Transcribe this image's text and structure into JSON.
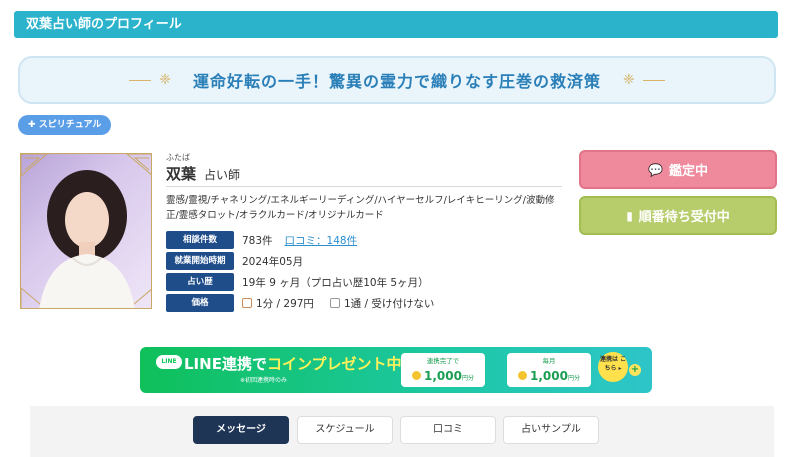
{
  "header": {
    "title": "双葉占い師のプロフィール"
  },
  "banner": {
    "text": "運命好転の一手！驚異の霊力で織りなす圧巻の救済策"
  },
  "tag": {
    "label": "スピリチュアル"
  },
  "profile": {
    "kana": "ふたば",
    "name": "双葉",
    "title": "占い師",
    "skills": "霊感/霊視/チャネリング/エネルギーリーディング/ハイヤーセルフ/レイキヒーリング/波動修正/霊感タロット/オラクルカード/オリジナルカード",
    "info": [
      {
        "label": "相談件数",
        "value": "783件",
        "link": "口コミ：148件"
      },
      {
        "label": "就業開始時期",
        "value": "2024年05月"
      },
      {
        "label": "占い歴",
        "value": "19年 9 ヶ月（プロ占い歴10年 5ヶ月）"
      },
      {
        "label": "価格",
        "phone_price": "1分 / 297円",
        "mail_price": "1通 / 受け付けない"
      }
    ]
  },
  "actions": {
    "status_label": "鑑定中",
    "queue_label": "順番待ち受付中"
  },
  "line_promo": {
    "badge": "LINE",
    "main_prefix": "LINE連携で",
    "main_highlight": "コインプレゼント中!",
    "note": "※初回連携時のみ",
    "reward1_caption": "連携完了で",
    "reward1_amount": "1,000",
    "reward1_unit": "円分",
    "reward2_caption": "毎月",
    "reward2_amount": "1,000",
    "reward2_unit": "円分",
    "plus": "+",
    "cta": "連携は こちら ▸"
  },
  "tabs": [
    "メッセージ",
    "スケジュール",
    "口コミ",
    "占いサンプル"
  ],
  "colors": {
    "header": "#2bb3cc",
    "status_button": "#ee8a9c",
    "queue_button": "#b7cd6c",
    "info_label": "#1f4d8a",
    "line_green": "#06c755",
    "active_tab": "#1e3555"
  }
}
